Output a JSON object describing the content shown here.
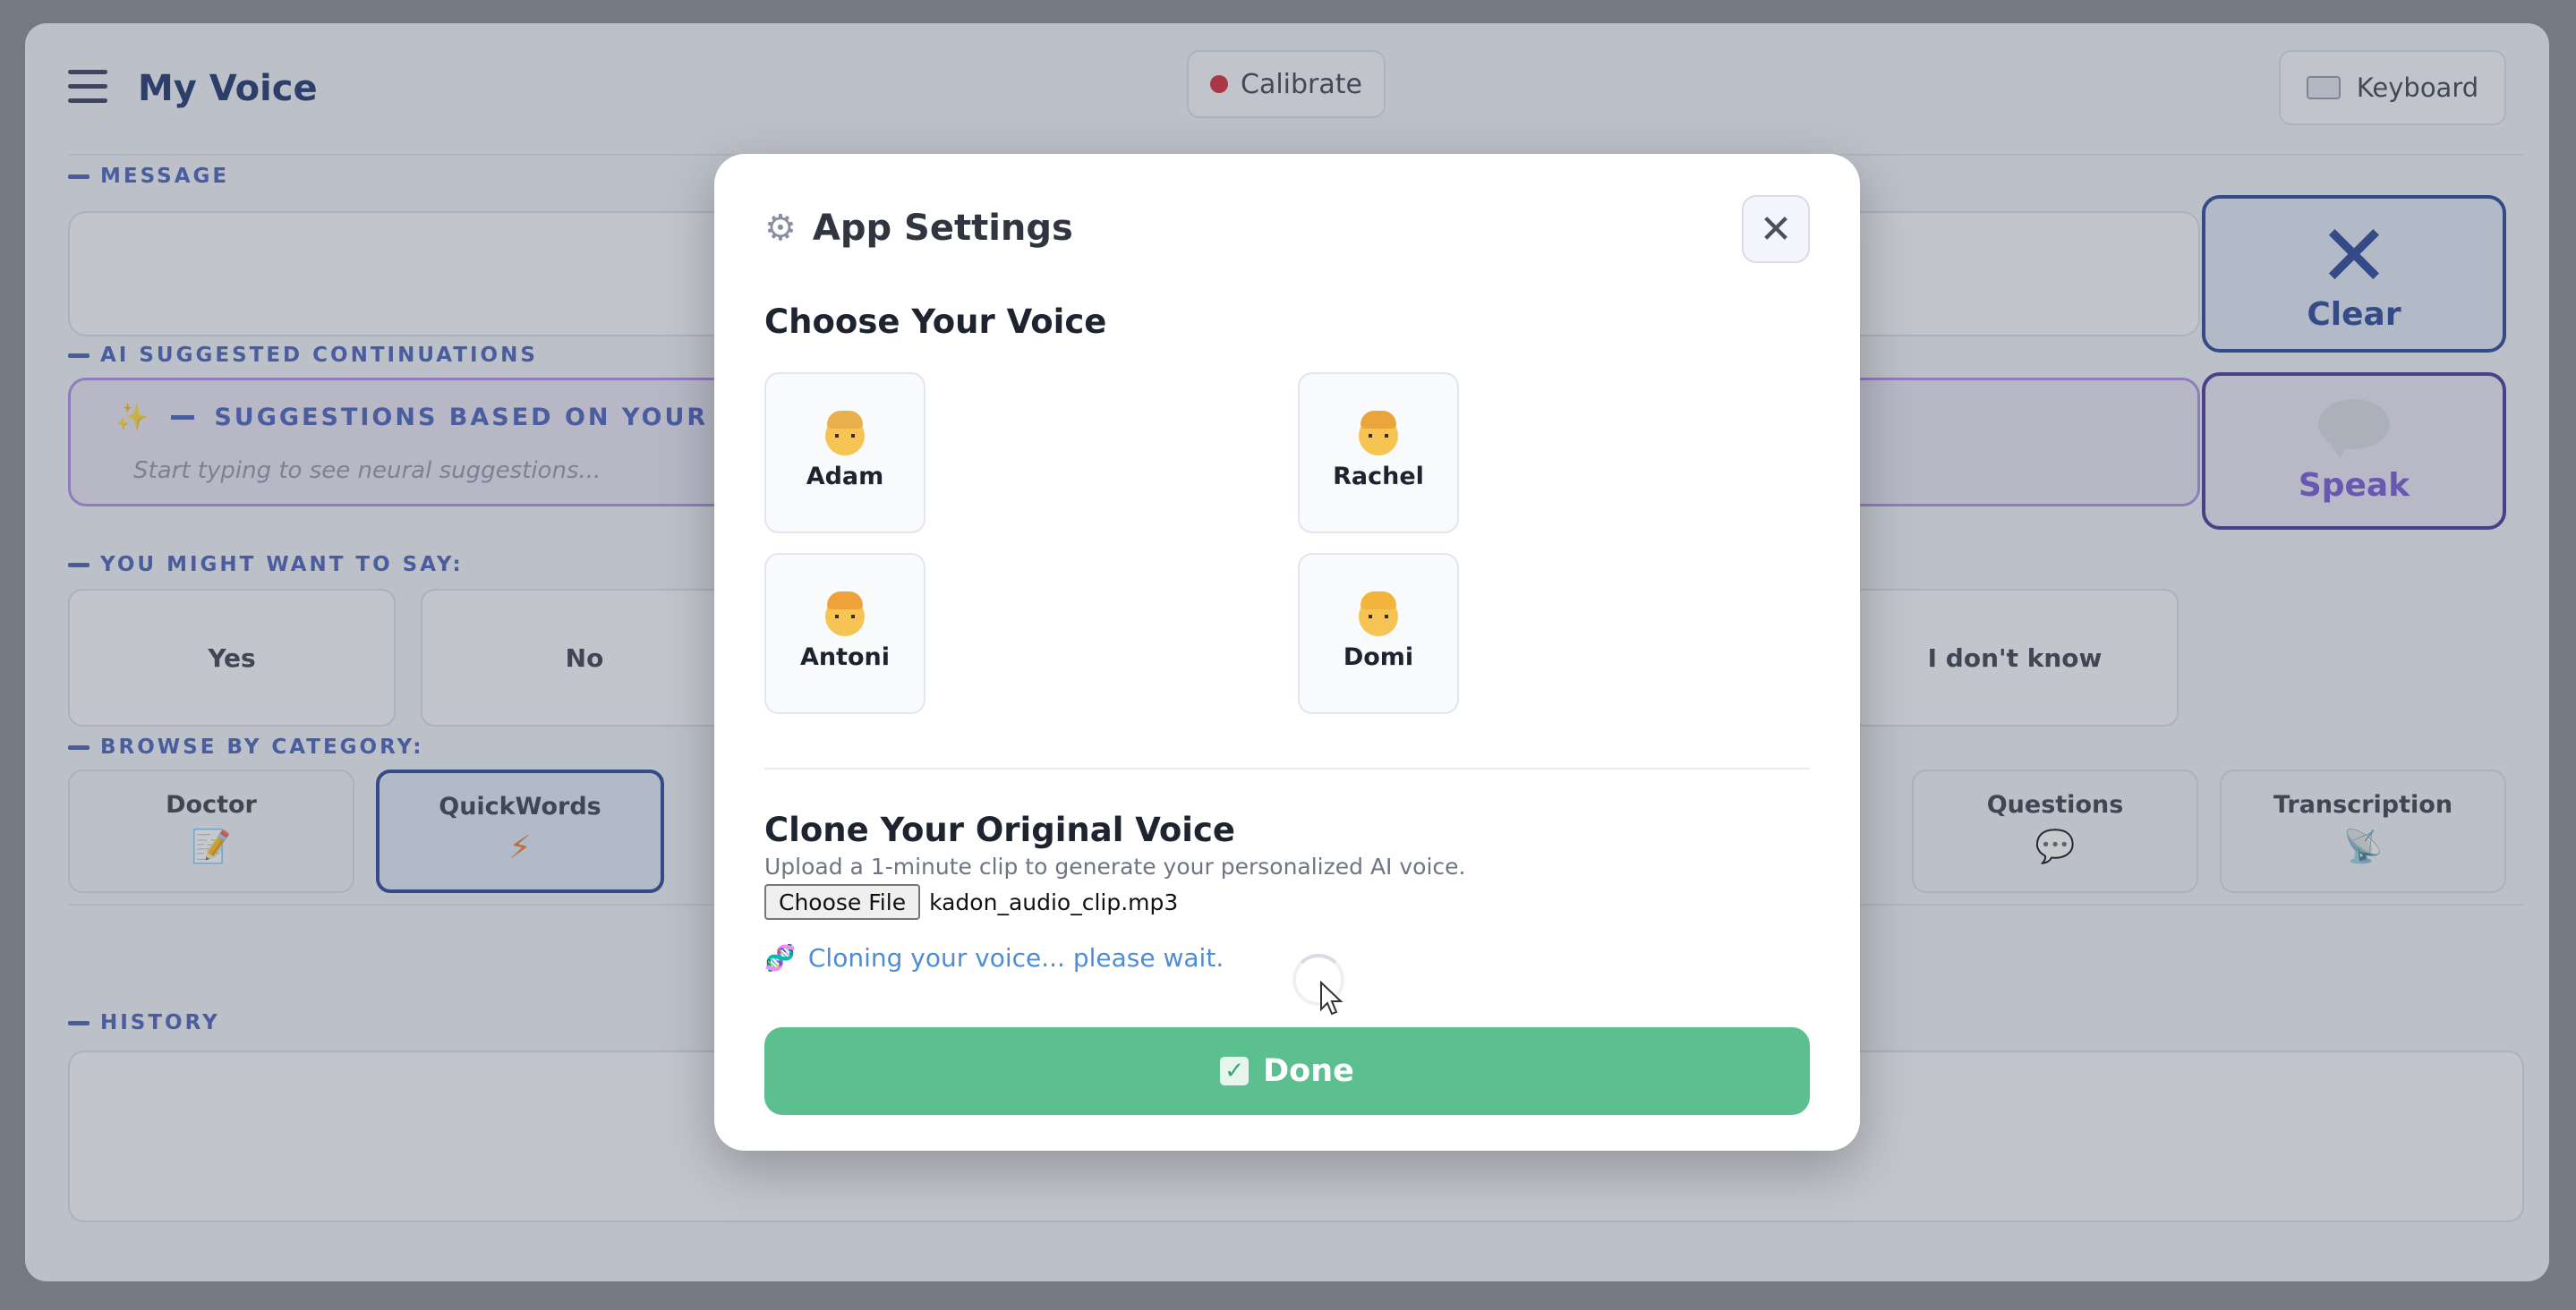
{
  "app": {
    "title": "My Voice",
    "calibrate_label": "Calibrate",
    "keyboard_label": "Keyboard",
    "message_label": "MESSAGE",
    "ai_label": "AI SUGGESTED CONTINUATIONS",
    "ai_heading": "SUGGESTIONS BASED ON YOUR MESSA",
    "ai_hint": "Start typing to see neural suggestions...",
    "clear_label": "Clear",
    "speak_label": "Speak",
    "might_say_label": "YOU MIGHT WANT TO SAY:",
    "phrases": [
      "Yes",
      "No",
      "I don't know"
    ],
    "browse_label": "BROWSE BY CATEGORY:",
    "categories": [
      {
        "label": "Doctor",
        "icon": "memo-icon"
      },
      {
        "label": "QuickWords",
        "icon": "lightning-icon"
      },
      {
        "label": "Questions",
        "icon": "speech-bubble-icon"
      },
      {
        "label": "Transcription",
        "icon": "satellite-icon"
      }
    ],
    "history_label": "HISTORY"
  },
  "modal": {
    "title": "App Settings",
    "choose_voice_title": "Choose Your Voice",
    "voices": [
      "Adam",
      "Rachel",
      "Antoni",
      "Domi"
    ],
    "clone_title": "Clone Your Original Voice",
    "clone_subtitle": "Upload a 1-minute clip to generate your personalized AI voice.",
    "file_button_label": "Choose File",
    "file_name": "kadon_audio_clip.mp3",
    "cloning_status": "Cloning your voice... please wait.",
    "done_label": "Done"
  },
  "colors": {
    "accent_blue": "#1b3a92",
    "done_green": "#5bbf8f",
    "status_blue": "#4d8dd8",
    "record_red": "#d21c2c"
  }
}
